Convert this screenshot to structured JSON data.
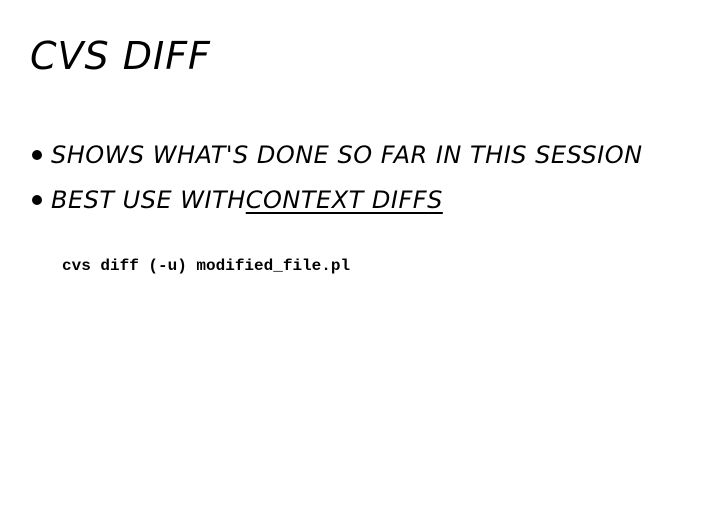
{
  "slide": {
    "title": "CVS DIFF",
    "bullets": [
      {
        "text": "SHOWS WHAT'S DONE SO FAR IN THIS SESSION"
      },
      {
        "prefix": "BEST USE WITH ",
        "emphasis": "CONTEXT DIFFS"
      }
    ],
    "code": "cvs diff (-u) modified_file.pl"
  }
}
